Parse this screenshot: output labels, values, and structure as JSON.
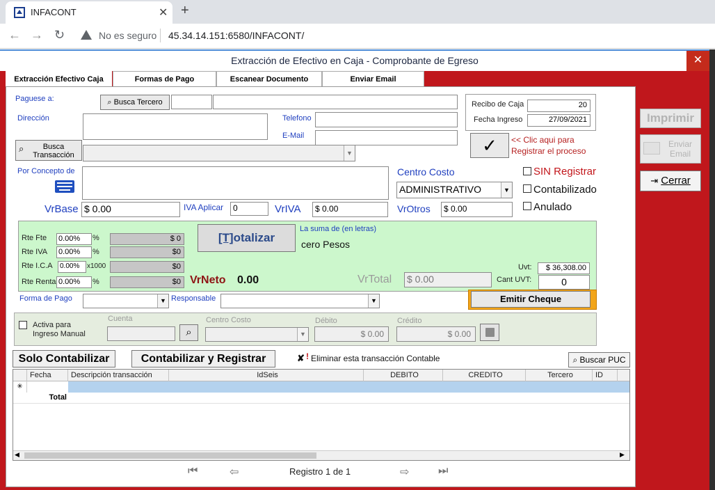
{
  "browser": {
    "tab_title": "INFACONT",
    "tab_close": "✕",
    "new_tab": "+",
    "security": "No es seguro",
    "url": "45.34.14.151:6580/INFACONT/"
  },
  "window": {
    "title": "Extracción de Efectivo en Caja - Comprobante de Egreso",
    "close": "✕"
  },
  "tabs": [
    {
      "label": "Extracción Efectivo Caja"
    },
    {
      "label": "Formas de Pago"
    },
    {
      "label": "Escanear Documento"
    },
    {
      "label": "Enviar Email"
    }
  ],
  "form": {
    "paguese_label": "Paguese a:",
    "busca_tercero": "Busca Tercero",
    "direccion_label": "Dirección",
    "telefono_label": "Telefono",
    "email_label": "E-Mail",
    "busca_transaccion": "Busca Transacción",
    "concepto_label": "Por Concepto de",
    "recibo_label": "Recibo de Caja",
    "recibo_value": "20",
    "fecha_label": "Fecha Ingreso",
    "fecha_value": "27/09/2021",
    "registrar_hint_1": "<< Clic aqui para",
    "registrar_hint_2": "Registrar el proceso",
    "centro_costo_label": "Centro Costo",
    "centro_costo_value": "ADMINISTRATIVO",
    "sin_registrar": "SIN Registrar",
    "contabilizado": "Contabilizado",
    "anulado": "Anulado",
    "vrbase_label": "VrBase",
    "vrbase_value": "$ 0.00",
    "iva_aplicar_label": "IVA Aplicar",
    "iva_aplicar_value": "0",
    "vriva_label": "VrIVA",
    "vriva_value": "$ 0.00",
    "vrotros_label": "VrOtros",
    "vrotros_value": "$ 0.00"
  },
  "retenciones": {
    "rows": [
      {
        "label": "Rte Fte",
        "pct": "0.00%",
        "suffix": "%",
        "value": "$ 0"
      },
      {
        "label": "Rte IVA",
        "pct": "0.00%",
        "suffix": "%",
        "value": "$0"
      },
      {
        "label": "Rte I.C.A",
        "pct": "0.00%",
        "suffix": "x1000",
        "value": "$0"
      },
      {
        "label": "Rte Renta",
        "pct": "0.00%",
        "suffix": "%",
        "value": "$0"
      }
    ],
    "totalizar_open": "[T]",
    "totalizar_rest": "otalizar",
    "suma_label": "La suma de (en letras)",
    "suma_value": "cero Pesos",
    "vrneto_label": "VrNeto",
    "vrneto_value": "0.00",
    "vrtotal_label": "VrTotal",
    "vrtotal_value": "$ 0.00",
    "uvt_label": "Uvt:",
    "uvt_value": "$ 36,308.00",
    "cant_uvt_label": "Cant UVT:",
    "cant_uvt_value": "0"
  },
  "pago": {
    "forma_label": "Forma de Pago",
    "responsable_label": "Responsable",
    "emitir_cheque": "Emitir Cheque"
  },
  "manual": {
    "activa_label_1": "Activa para",
    "activa_label_2": "Ingreso Manual",
    "cuenta_label": "Cuenta",
    "centro_label": "Centro Costo",
    "debito_label": "Débito",
    "debito_value": "$ 0.00",
    "credito_label": "Crédito",
    "credito_value": "$ 0.00"
  },
  "actions": {
    "solo_contabilizar": "Solo Contabilizar",
    "contabilizar_registrar": "Contabilizar y Registrar",
    "eliminar": "Eliminar esta transacción Contable",
    "buscar_puc": "Buscar PUC"
  },
  "grid": {
    "columns": [
      "Fecha",
      "Descripción transacción",
      "IdSeis",
      "DEBITO",
      "CREDITO",
      "Tercero",
      "ID"
    ],
    "new_row_marker": "✳",
    "total_label": "Total"
  },
  "pager": {
    "text": "Registro 1 de 1"
  },
  "side": {
    "imprimir": "Imprimir",
    "enviar_email_1": "Enviar",
    "enviar_email_2": "Email",
    "cerrar": "Cerrar"
  },
  "colors": {
    "window_red": "#c0171c",
    "label_blue": "#1f3fbf",
    "green_panel": "#ccf7cc",
    "selected_row": "#b4d2ee"
  }
}
